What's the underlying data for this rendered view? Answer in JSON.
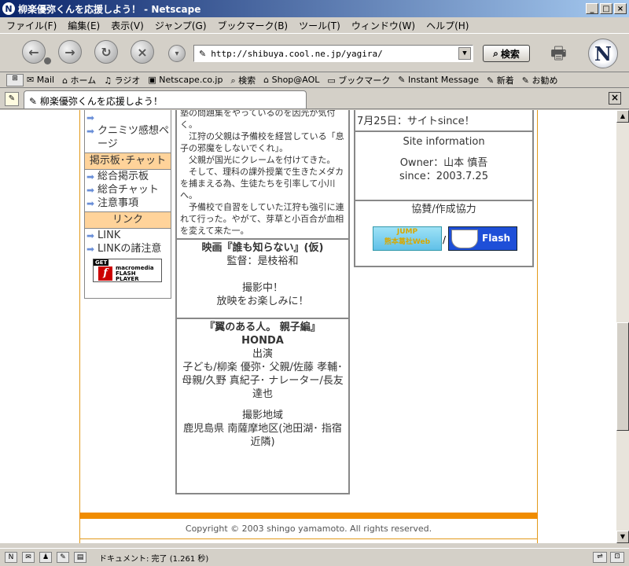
{
  "window": {
    "title": "柳楽優弥くんを応援しよう！ - Netscape",
    "app_icon": "N",
    "minimize": "_",
    "maximize": "□",
    "close": "×"
  },
  "menubar": {
    "items": [
      "ファイル(F)",
      "編集(E)",
      "表示(V)",
      "ジャンプ(G)",
      "ブックマーク(B)",
      "ツール(T)",
      "ウィンドウ(W)",
      "ヘルプ(H)"
    ]
  },
  "navbar": {
    "url": "http://shibuya.cool.ne.jp/yagira/",
    "search_label": "検索",
    "logo": "N"
  },
  "personal_toolbar": {
    "items": [
      "Mail",
      "ホーム",
      "ラジオ",
      "Netscape.co.jp",
      "検索",
      "Shop@AOL",
      "ブックマーク",
      "Instant Message",
      "新着",
      "お勧め"
    ]
  },
  "tab": {
    "title": "柳楽優弥くんを応援しよう！"
  },
  "left_menu": {
    "items_top": [
      "クニミツ感想ページ"
    ],
    "section1": "掲示板･チャット",
    "section1_items": [
      "総合掲示板",
      "総合チャット",
      "注意事項"
    ],
    "section2": "リンク",
    "section2_items": [
      "LINK",
      "LINKの諸注意"
    ],
    "flash_badge": {
      "get": "GET",
      "line1": "macromedia",
      "line2": "FLASH",
      "line3": "PLAYER"
    }
  },
  "middle": {
    "story": [
      "塾の問題集をやっているのを因光が気付く。",
      "　江狩の父親は予備校を経営している「息子の邪魔をしないでくれ」。",
      "　父親が国光にクレームを付けてきた。",
      "　そして、理科の課外授業で生きたメダカを捕まえる為、生徒たちを引率して小川へ。",
      "　予備校で自習をしていた江狩も強引に連れて行った。やがて、芽草と小百合が血相を変えて来た一。"
    ],
    "movie": {
      "title": "映画『誰も知らない』(仮)",
      "director": "監督：是枝裕和",
      "status1": "撮影中！",
      "status2": "放映をお楽しみに！"
    },
    "drama": {
      "title": "『翼のある人。 親子編』",
      "sponsor": "HONDA",
      "cast_label": "出演",
      "cast": "子ども/柳楽 優弥･ 父親/佐藤 孝輔･ 母親/久野 真紀子･ ナレーター/長友達也",
      "location_label": "撮影地域",
      "location": "鹿児島県 南薩摩地区(池田湖･ 指宿近隣)"
    }
  },
  "right": {
    "since_line": "7月25日：サイトsince！",
    "site_info_title": "Site information",
    "owner": "Owner：山本 慎吾",
    "since": "since：2003.7.25",
    "cooperation_title": "協賛/作成協力",
    "separator": "/",
    "banner1_line1": "JUMP",
    "banner1_line2": "熊本葛社Web",
    "banner2_label": "Flash"
  },
  "footer": {
    "copyright": "Copyright © 2003 shingo yamamoto. All rights reserved."
  },
  "status": {
    "text": "ドキュメント: 完了 (1.261 秒)"
  },
  "colors": {
    "accent_orange": "#f08c00",
    "menu_header_bg": "#ffd39a",
    "titlebar": "#0a246a"
  }
}
